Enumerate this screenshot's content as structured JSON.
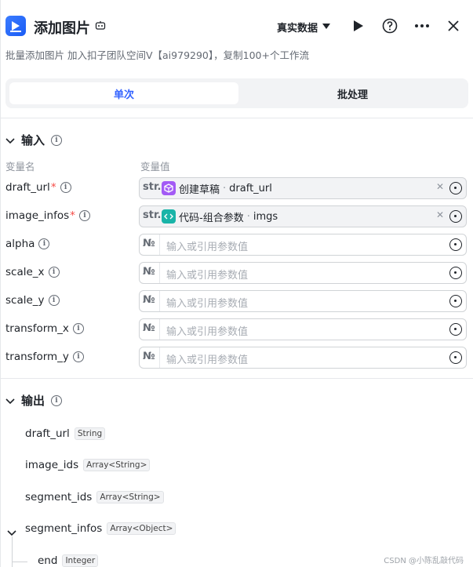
{
  "header": {
    "title": "添加图片",
    "datasource_label": "真实数据",
    "subtitle": "批量添加图片 加入扣子团队空间V【ai979290】，复制100+个工作流"
  },
  "tabs": [
    {
      "label": "单次"
    },
    {
      "label": "批处理"
    }
  ],
  "input_section": {
    "title": "输入",
    "col_name": "变量名",
    "col_value": "变量值",
    "rows": [
      {
        "name": "draft_url",
        "required": "*",
        "type": "str.",
        "ref_source": "创建草稿",
        "ref_sep": "·",
        "ref_var": "draft_url"
      },
      {
        "name": "image_infos",
        "required": "*",
        "type": "str.",
        "ref_source": "代码-组合参数",
        "ref_sep": "·",
        "ref_var": "imgs"
      },
      {
        "name": "alpha",
        "type": "№",
        "placeholder": "输入或引用参数值"
      },
      {
        "name": "scale_x",
        "type": "№",
        "placeholder": "输入或引用参数值"
      },
      {
        "name": "scale_y",
        "type": "№",
        "placeholder": "输入或引用参数值"
      },
      {
        "name": "transform_x",
        "type": "№",
        "placeholder": "输入或引用参数值"
      },
      {
        "name": "transform_y",
        "type": "№",
        "placeholder": "输入或引用参数值"
      }
    ]
  },
  "output_section": {
    "title": "输出",
    "items": [
      {
        "name": "draft_url",
        "type": "String"
      },
      {
        "name": "image_ids",
        "type": "Array<String>"
      },
      {
        "name": "segment_ids",
        "type": "Array<String>"
      },
      {
        "name": "segment_infos",
        "type": "Array<Object>"
      },
      {
        "name": "end",
        "type": "Integer"
      }
    ]
  },
  "watermark": "CSDN @小陈乱敲代码",
  "colors": {
    "accent": "#3363ff",
    "required": "#f54a45",
    "ref_purple": "#a35bf5",
    "ref_teal": "#19b4a8"
  }
}
